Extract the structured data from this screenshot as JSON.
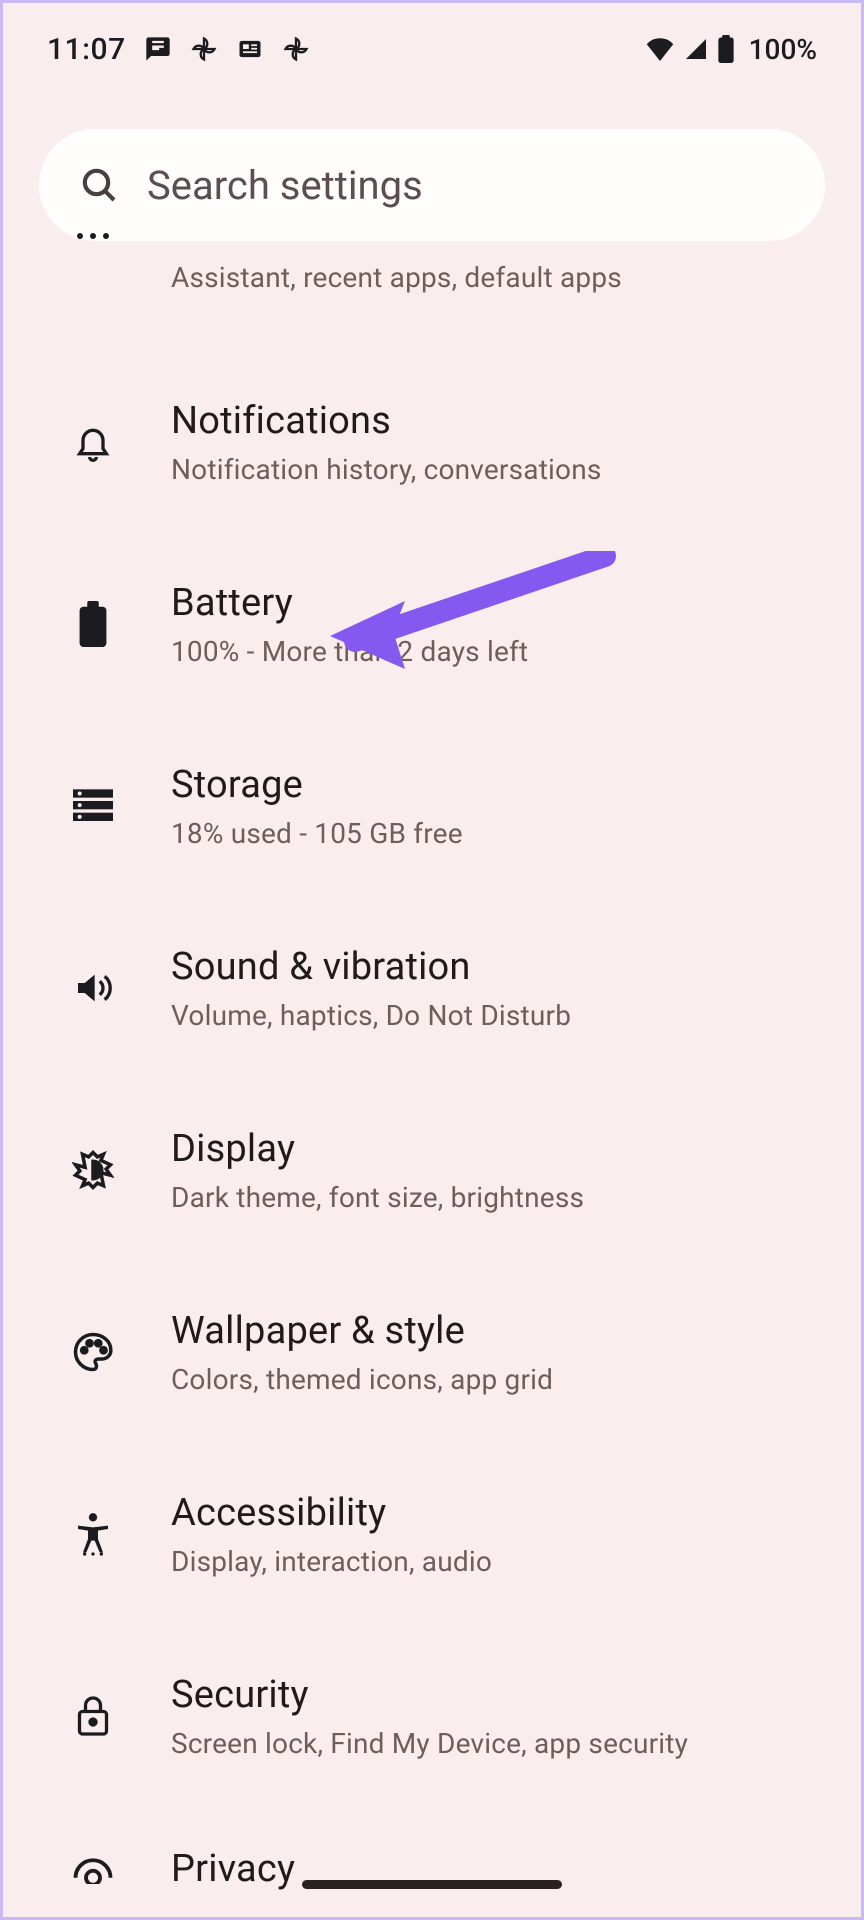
{
  "status_bar": {
    "time": "11:07",
    "battery_percent": "100%"
  },
  "search": {
    "placeholder": "Search settings"
  },
  "apps_partial": {
    "subtitle": "Assistant, recent apps, default apps"
  },
  "items": [
    {
      "title": "Notifications",
      "subtitle": "Notification history, conversations"
    },
    {
      "title": "Battery",
      "subtitle": "100% - More than 2 days left"
    },
    {
      "title": "Storage",
      "subtitle": "18% used - 105 GB free"
    },
    {
      "title": "Sound & vibration",
      "subtitle": "Volume, haptics, Do Not Disturb"
    },
    {
      "title": "Display",
      "subtitle": "Dark theme, font size, brightness"
    },
    {
      "title": "Wallpaper & style",
      "subtitle": "Colors, themed icons, app grid"
    },
    {
      "title": "Accessibility",
      "subtitle": "Display, interaction, audio"
    },
    {
      "title": "Security",
      "subtitle": "Screen lock, Find My Device, app security"
    }
  ],
  "privacy_partial": {
    "title": "Privacy"
  },
  "annotation": {
    "arrow_color": "#8559f0"
  }
}
